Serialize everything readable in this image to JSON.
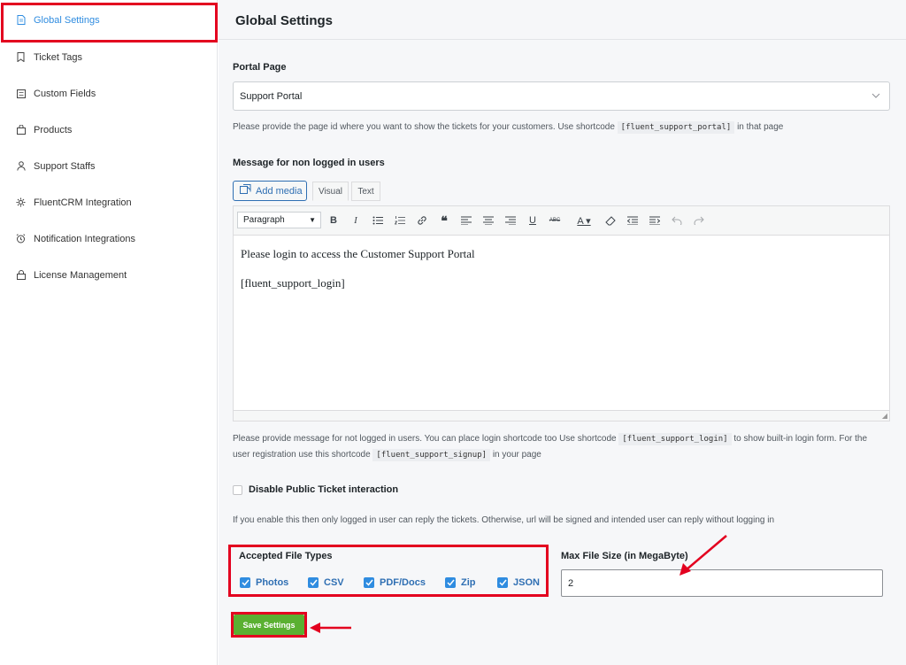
{
  "sidebar": {
    "items": [
      {
        "label": "Global Settings",
        "icon": "document-icon",
        "active": true
      },
      {
        "label": "Ticket Tags",
        "icon": "bookmark-icon"
      },
      {
        "label": "Custom Fields",
        "icon": "form-icon"
      },
      {
        "label": "Products",
        "icon": "bag-icon"
      },
      {
        "label": "Support Staffs",
        "icon": "user-icon"
      },
      {
        "label": "FluentCRM Integration",
        "icon": "gear-icon"
      },
      {
        "label": "Notification Integrations",
        "icon": "alarm-icon"
      },
      {
        "label": "License Management",
        "icon": "lock-icon"
      }
    ]
  },
  "header": {
    "title": "Global Settings"
  },
  "portal": {
    "label": "Portal Page",
    "selected": "Support Portal",
    "help_before": "Please provide the page id where you want to show the tickets for your customers. Use shortcode",
    "help_code": "[fluent_support_portal]",
    "help_after": "in that page"
  },
  "message": {
    "label": "Message for non logged in users",
    "add_media": "Add media",
    "tab_visual": "Visual",
    "tab_text": "Text",
    "format_select": "Paragraph",
    "content_line1": "Please login to access the Customer Support Portal",
    "content_line2": "[fluent_support_login]",
    "help_part1": "Please provide message for not logged in users. You can place login shortcode too Use shortcode",
    "help_code1": "[fluent_support_login]",
    "help_part2": "to show built-in login form. For the",
    "help_part3": "user registration use this shortcode",
    "help_code2": "[fluent_support_signup]",
    "help_part4": "in your page"
  },
  "public_ticket": {
    "label": "Disable Public Ticket interaction",
    "checked": false,
    "help": "If you enable this then only logged in user can reply the tickets. Otherwise, url will be signed and intended user can reply without logging in"
  },
  "file_types": {
    "label": "Accepted File Types",
    "options": [
      {
        "label": "Photos",
        "checked": true
      },
      {
        "label": "CSV",
        "checked": true
      },
      {
        "label": "PDF/Docs",
        "checked": true
      },
      {
        "label": "Zip",
        "checked": true
      },
      {
        "label": "JSON",
        "checked": true
      }
    ]
  },
  "max_file_size": {
    "label": "Max File Size (in MegaByte)",
    "value": "2"
  },
  "save_button": {
    "label": "Save Settings"
  },
  "colors": {
    "accent": "#2f8ce0",
    "save": "#5ab031",
    "highlight": "#e3001f"
  }
}
